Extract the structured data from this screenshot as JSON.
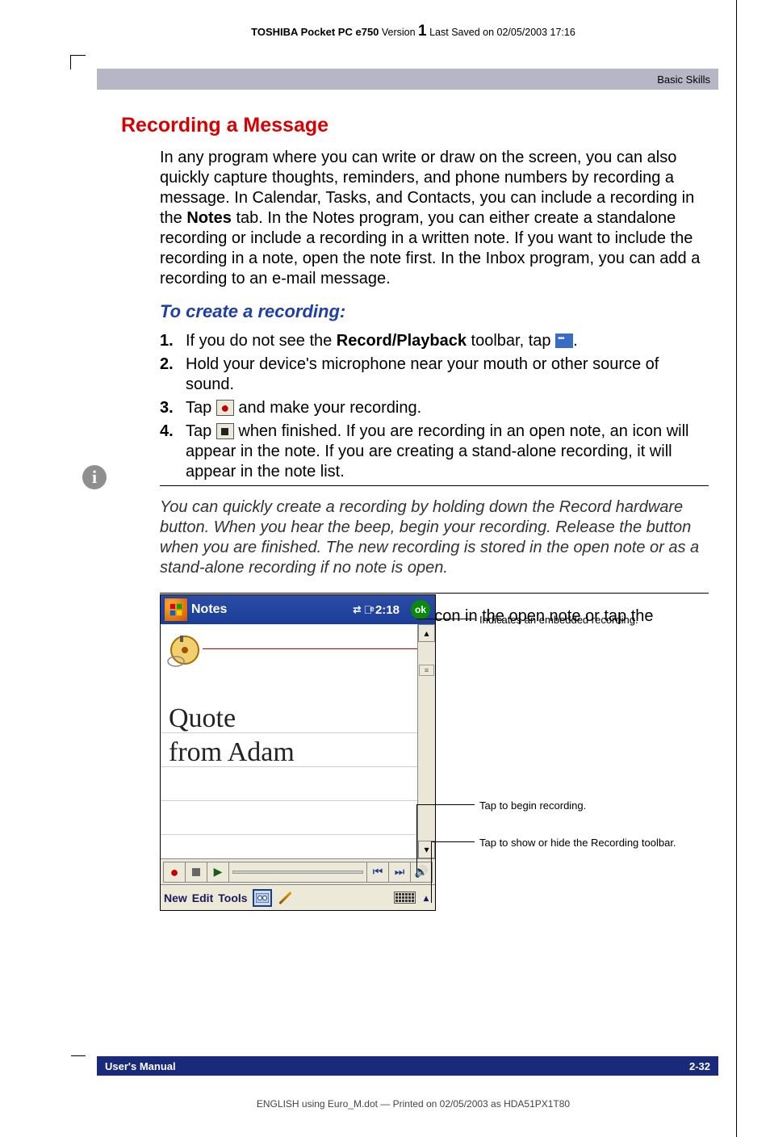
{
  "header": {
    "product_prefix": "TOSHIBA Pocket PC e750",
    "version_label": " Version ",
    "version_num": "1",
    "saved": " Last Saved on 02/05/2003 17:16"
  },
  "band_top": {
    "breadcrumb": "Basic Skills"
  },
  "section": {
    "title": "Recording a Message",
    "intro_a": "In any program where you can write or draw on the screen, you can also quickly capture thoughts, reminders, and phone numbers by recording a message. In Calendar, Tasks, and Contacts, you can include a recording in the ",
    "intro_bold": "Notes",
    "intro_b": " tab. In the Notes program, you can either create a standalone recording or include a recording in a written note. If you want to include the recording in a note, open the note first. In the Inbox program, you can add a recording to an e-mail message.",
    "subhead": "To create a recording:",
    "steps": [
      {
        "num": "1.",
        "pre": "If you do not see the ",
        "bold": "Record/Playback",
        "post": " toolbar, tap ",
        "icon": "cassette",
        "tail": "."
      },
      {
        "num": "2.",
        "pre": "Hold your device's microphone near your mouth or other source of sound.",
        "bold": "",
        "post": "",
        "icon": "",
        "tail": ""
      },
      {
        "num": "3.",
        "pre": "Tap ",
        "bold": "",
        "post": "",
        "icon": "record",
        "tail": " and make your recording."
      },
      {
        "num": "4.",
        "pre": "Tap ",
        "bold": "",
        "post": "",
        "icon": "stop",
        "tail": " when finished. If you are recording in an open note, an icon will appear in the note. If you are creating a stand-alone recording, it will appear in the note list."
      }
    ],
    "note": "You can quickly create a recording by holding down the Record hardware button. When you hear the beep, begin your recording. Release the button when you are finished. The new recording is stored in the open note or as a stand-alone recording if no note is open.",
    "post_note": "To play a recording, tap the recording icon in the open note or tap the recording in the note list."
  },
  "screenshot": {
    "app_title": "Notes",
    "time": "2:18",
    "ok": "ok",
    "hand1": "Quote",
    "hand2": "from Adam",
    "menubar": {
      "new": "New",
      "edit": "Edit",
      "tools": "Tools"
    },
    "callouts": {
      "embedded": "Indicates an embedded recording.",
      "begin": "Tap to begin recording.",
      "toolbar": "Tap to show or hide the Recording toolbar."
    }
  },
  "band_bottom": {
    "left": "User's Manual",
    "right": "2-32"
  },
  "footer": "ENGLISH using Euro_M.dot — Printed on 02/05/2003 as HDA51PX1T80"
}
